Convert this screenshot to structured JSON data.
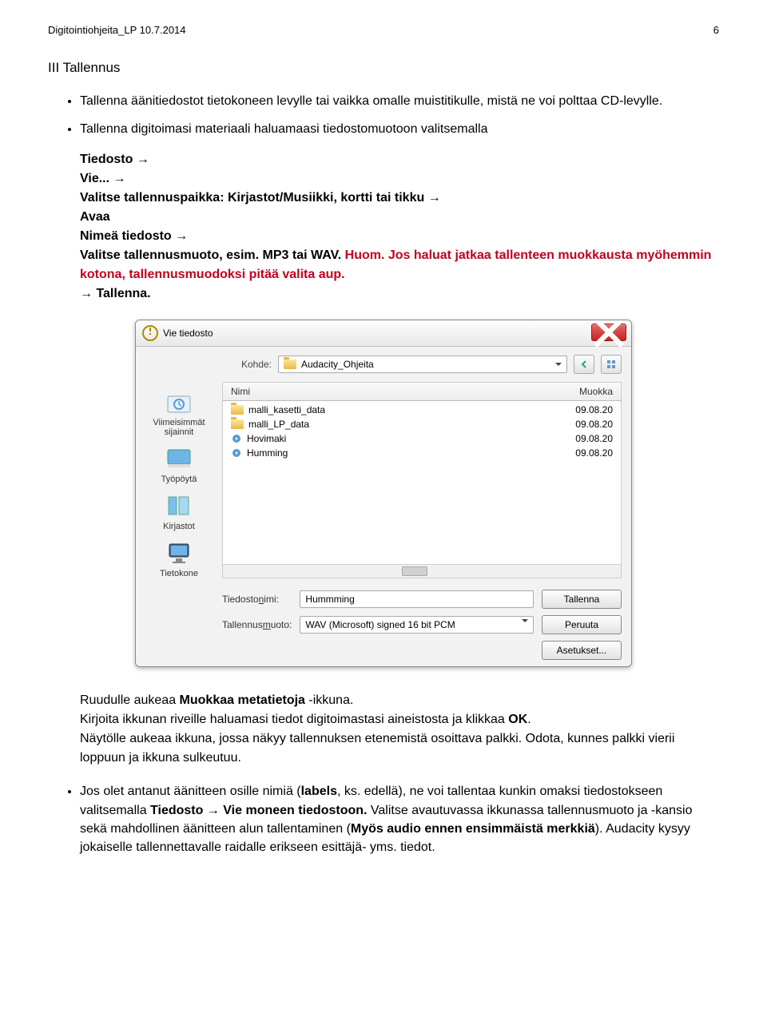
{
  "header": {
    "left": "Digitointiohjeita_LP  10.7.2014",
    "right": "6"
  },
  "section_title": "III Tallennus",
  "bullets": [
    "Tallenna äänitiedostot tietokoneen levylle tai vaikka omalle muistitikulle, mistä ne voi polttaa CD-levylle.",
    "Tallenna digitoimasi materiaali haluamaasi tiedostomuotoon valitsemalla"
  ],
  "steps": {
    "line1": "Tiedosto →",
    "line2": "Vie... →",
    "line3": "Valitse tallennuspaikka: Kirjastot/Musiikki, kortti tai tikku →",
    "line4": "Avaa",
    "line5": "Nimeä tiedosto →",
    "line6_a": "Valitse tallennusmuoto, esim. ",
    "line6_b": "MP3 tai WAV. ",
    "line6_c": "Huom. Jos haluat jatkaa tallenteen muokkausta myöhemmin kotona, tallennusmuodoksi pitää valita aup.",
    "line7": "→ Tallenna."
  },
  "dialog": {
    "title": "Vie tiedosto",
    "kohde_label": "Kohde:",
    "kohde_value": "Audacity_Ohjeita",
    "col_name": "Nimi",
    "col_mod": "Muokka",
    "files": [
      {
        "name": "malli_kasetti_data",
        "type": "folder",
        "mod": "09.08.20"
      },
      {
        "name": "malli_LP_data",
        "type": "folder",
        "mod": "09.08.20"
      },
      {
        "name": "Hovimaki",
        "type": "audio",
        "mod": "09.08.20"
      },
      {
        "name": "Humming",
        "type": "audio",
        "mod": "09.08.20"
      }
    ],
    "places": [
      "Viimeisimmät sijainnit",
      "Työpöytä",
      "Kirjastot",
      "Tietokone"
    ],
    "filename_label_pre": "Tiedosto",
    "filename_label_u": "n",
    "filename_label_post": "imi:",
    "filename_value": "Hummming",
    "format_label_pre": "Tallennus",
    "format_label_u": "m",
    "format_label_post": "uoto:",
    "format_value": "WAV (Microsoft) signed 16 bit PCM",
    "btn_save": "Tallenna",
    "btn_cancel": "Peruuta",
    "btn_settings": "Asetukset..."
  },
  "after": {
    "p1a": "Ruudulle aukeaa ",
    "p1b": "Muokkaa metatietoja",
    "p1c": " -ikkuna.",
    "p2a": "Kirjoita ikkunan riveille haluamasi tiedot digitoimastasi aineistosta ja klikkaa ",
    "p2b": "OK",
    "p2c": ".",
    "p3": "Näytölle aukeaa ikkuna, jossa näkyy tallennuksen etenemistä osoittava palkki. Odota, kunnes palkki vierii loppuun ja ikkuna sulkeutuu."
  },
  "last_bullet": {
    "a": "Jos olet antanut äänitteen osille nimiä (",
    "b": "labels",
    "c": ", ks. edellä), ne voi tallentaa kunkin omaksi tiedostokseen valitsemalla ",
    "d": "Tiedosto → Vie moneen tiedostoon.",
    "e": " Valitse avautuvassa ikkunassa tallennusmuoto ja -kansio sekä mahdollinen äänitteen alun tallentaminen (",
    "f": "Myös audio ennen ensimmäistä merkkiä",
    "g": ").  Audacity kysyy jokaiselle tallennettavalle raidalle erikseen esittäjä- yms. tiedot."
  }
}
